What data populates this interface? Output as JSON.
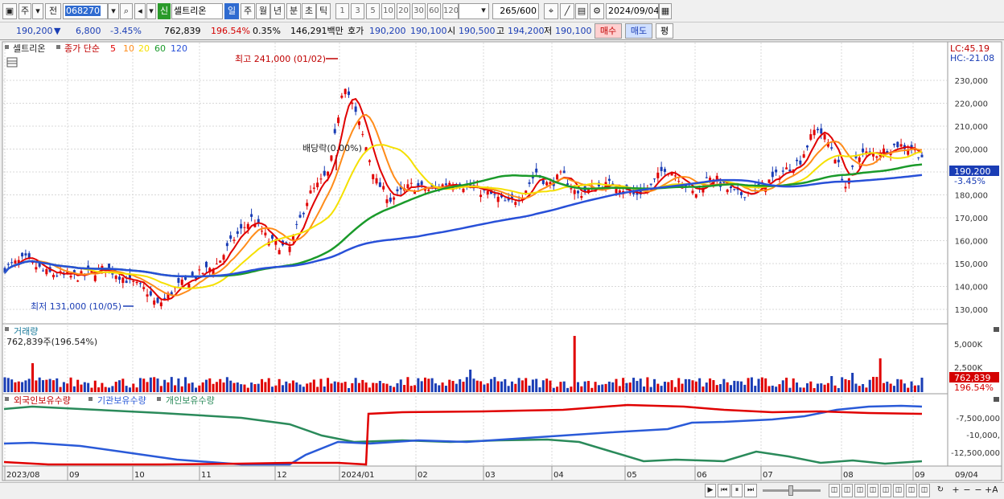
{
  "toolbar": {
    "mode_label": "주",
    "ref_label": "전",
    "stock_code": "068270",
    "stock_tag": "신",
    "stock_name": "셀트리온",
    "periods": [
      "일",
      "주",
      "월",
      "년",
      "분",
      "초",
      "틱"
    ],
    "active_period": "일",
    "intervals": [
      "1",
      "3",
      "5",
      "10",
      "20",
      "30",
      "60",
      "120"
    ],
    "count": "265",
    "count_total": "/600",
    "date": "2024/09/04"
  },
  "quote": {
    "price": "190,200",
    "change": "6,800",
    "change_pct": "-3.45%",
    "volume": "762,839",
    "vol_ratio": "196.54%",
    "turnover": "0.35%",
    "amount": "146,291백만",
    "bid_label": "호가",
    "bid1": "190,200",
    "bid2": "190,100",
    "open_label": "시",
    "open": "190,500",
    "high_label": "고",
    "high": "194,200",
    "low_label": "저",
    "low": "190,100",
    "buy_label": "매수",
    "sell_label": "매도",
    "eval_label": "평"
  },
  "price_panel": {
    "stock_name": "셀트리온",
    "ma_title": "종가 단순",
    "ma_periods": [
      "5",
      "10",
      "20",
      "60",
      "120"
    ],
    "ma_colors": [
      "#e00000",
      "#ff8c1a",
      "#f5e000",
      "#1a9a2a",
      "#2850d8"
    ],
    "lc": "LC:45.19",
    "hc": "HC:-21.08",
    "high_note": "최고 241,000 (01/02)",
    "low_note": "최저 131,000 (10/05)",
    "dividend_note": "배당락(0.00%)",
    "last_price": "190,200",
    "last_pct": "-3.45%",
    "y_ticks": [
      "230,000",
      "220,000",
      "210,000",
      "200,000",
      "190,000",
      "180,000",
      "170,000",
      "160,000",
      "150,000",
      "140,000",
      "130,000"
    ]
  },
  "volume_panel": {
    "title": "거래량",
    "value": "762,839주(196.54%)",
    "y_ticks": [
      "5,000K",
      "2,500K"
    ],
    "last_value": "762,839",
    "last_pct": "196.54%"
  },
  "holding_panel": {
    "legends": [
      "외국인보유수량",
      "기관보유수량",
      "개인보유수량"
    ],
    "y_ticks": [
      "-7,500,000",
      "-10,000,",
      "-12,500,000"
    ]
  },
  "x_axis": {
    "labels": [
      "2023/08",
      "09",
      "10",
      "11",
      "12",
      "2024/01",
      "02",
      "03",
      "04",
      "05",
      "06",
      "07",
      "08",
      "09"
    ],
    "end_date": "09/04"
  },
  "colors": {
    "up": "#e00000",
    "down": "#1a3db5",
    "selected": "#2f6bd0"
  }
}
